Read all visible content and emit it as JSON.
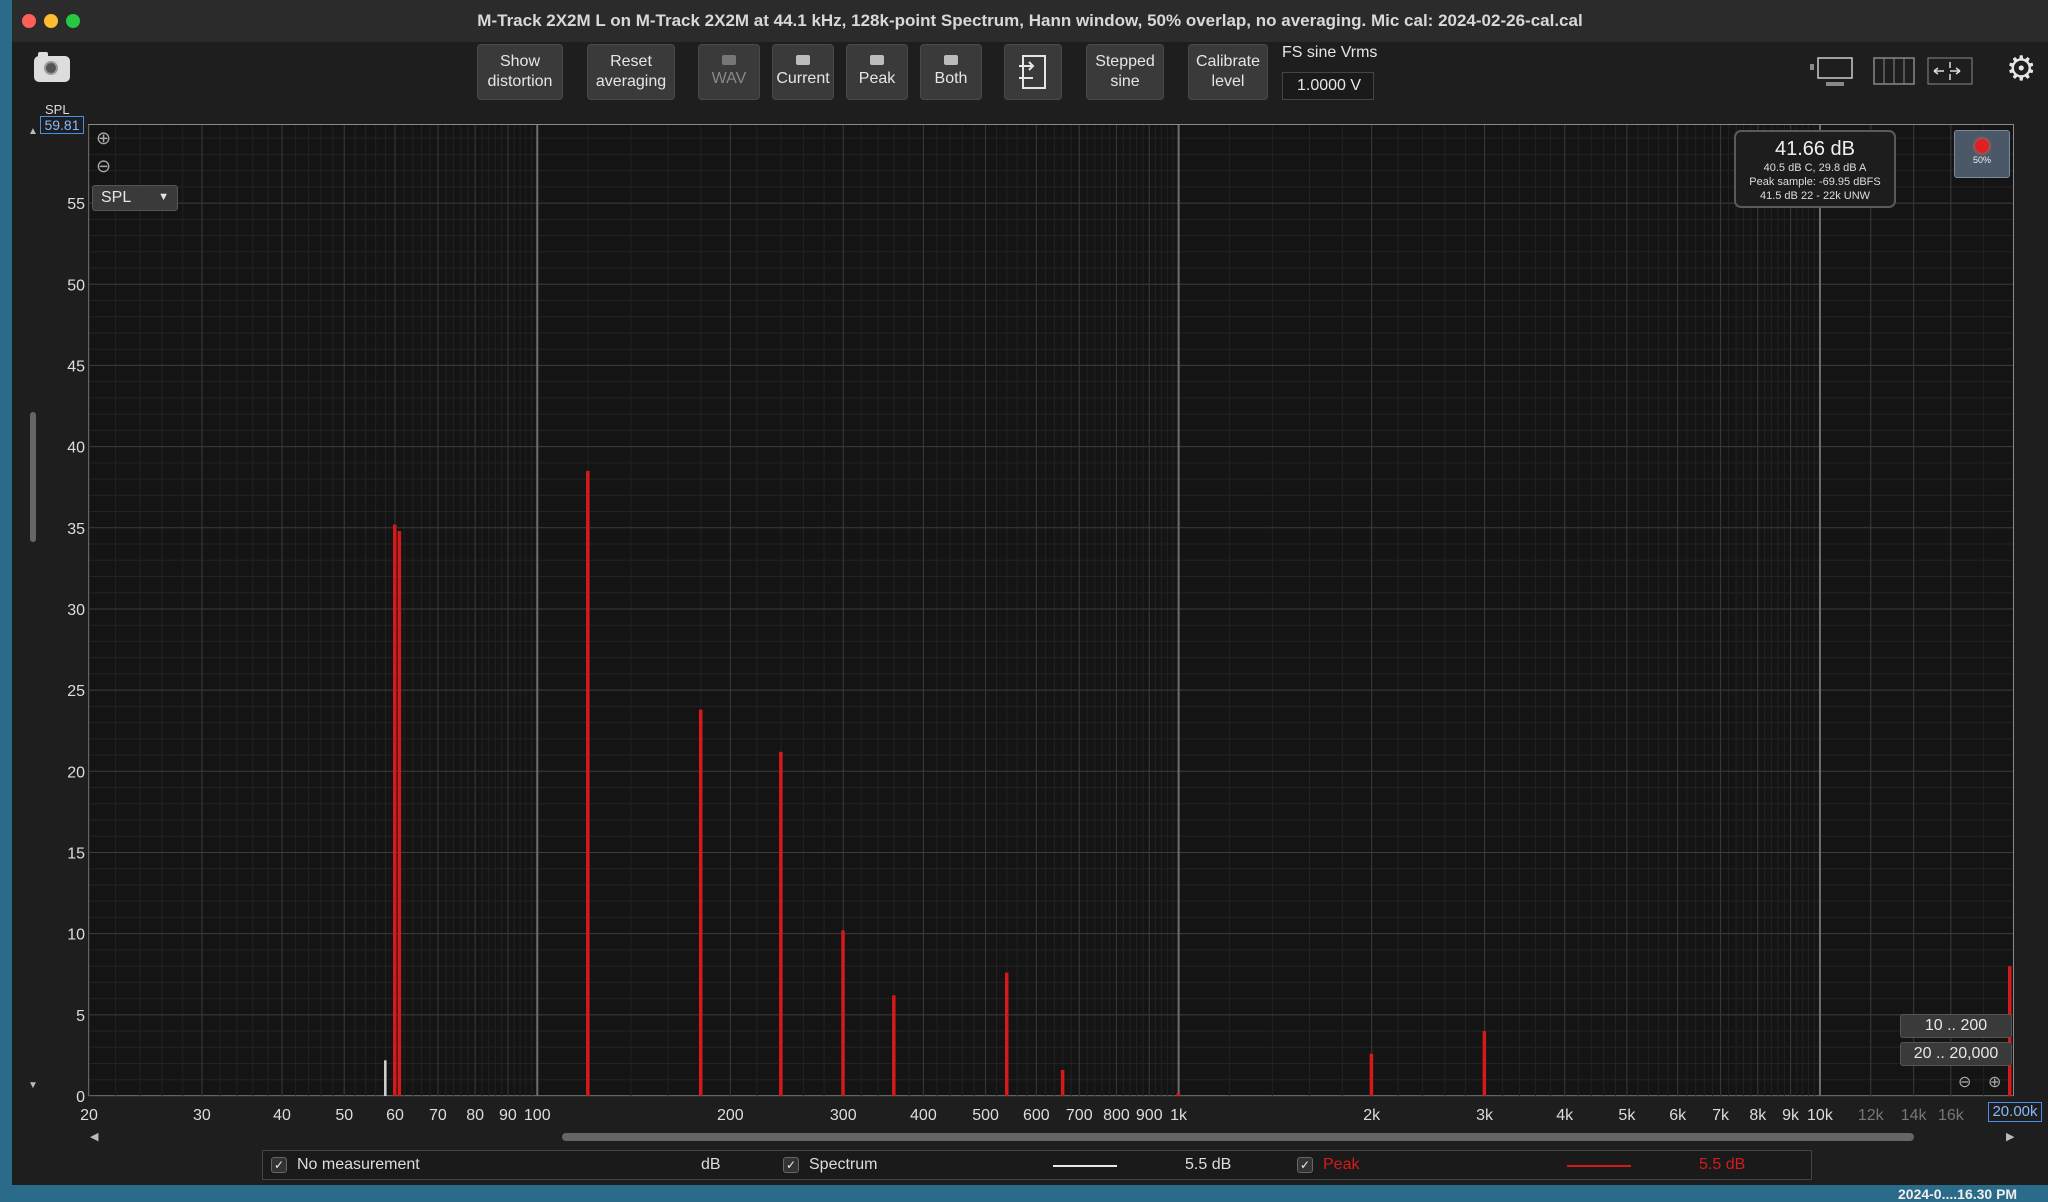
{
  "window": {
    "title": "M-Track 2X2M  L on M-Track 2X2M at 44.1 kHz, 128k-point Spectrum, Hann window, 50% overlap, no averaging. Mic cal: 2024-02-26-cal.cal"
  },
  "toolbar": {
    "show_distortion": [
      "Show",
      "distortion"
    ],
    "reset_averaging": [
      "Reset",
      "averaging"
    ],
    "wav": "WAV",
    "current": "Current",
    "peak": "Peak",
    "both": "Both",
    "stepped_sine": [
      "Stepped",
      "sine"
    ],
    "calibrate_level": [
      "Calibrate",
      "level"
    ],
    "fs_sine_label": "FS sine Vrms",
    "fs_sine_value": "1.0000 V"
  },
  "axis": {
    "y_title": "SPL",
    "y_max_value": "59.81",
    "x_max_value": "20.00k",
    "y_selector": "SPL"
  },
  "readout": {
    "main": "41.66 dB",
    "line1": "40.5 dB C, 29.8 dB A",
    "line2": "Peak sample: -69.95 dBFS",
    "line3": "41.5 dB 22 - 22k UNW",
    "record_pct": "50%"
  },
  "ranges": {
    "r1": "10 .. 200",
    "r2": "20 .. 20,000"
  },
  "legend": {
    "no_measurement": "No measurement",
    "unit": "dB",
    "spectrum": "Spectrum",
    "spectrum_value": "5.5 dB",
    "peak": "Peak",
    "peak_value": "5.5 dB",
    "spectrum_color": "#e8e8e8",
    "peak_color": "#d41a1a"
  },
  "desktop": {
    "clock": "2024-0....16.30 PM"
  },
  "chart_data": {
    "type": "bar",
    "x_scale": "log",
    "xlim": [
      20,
      20000
    ],
    "ylim": [
      0,
      59.81
    ],
    "ylabel": "SPL",
    "grid": true,
    "y_ticks": [
      0,
      5,
      10,
      15,
      20,
      25,
      30,
      35,
      40,
      45,
      50,
      55
    ],
    "x_ticks": [
      {
        "v": 20,
        "l": "20"
      },
      {
        "v": 30,
        "l": "30"
      },
      {
        "v": 40,
        "l": "40"
      },
      {
        "v": 50,
        "l": "50"
      },
      {
        "v": 60,
        "l": "60"
      },
      {
        "v": 70,
        "l": "70"
      },
      {
        "v": 80,
        "l": "80"
      },
      {
        "v": 90,
        "l": "90"
      },
      {
        "v": 100,
        "l": "100"
      },
      {
        "v": 200,
        "l": "200"
      },
      {
        "v": 300,
        "l": "300"
      },
      {
        "v": 400,
        "l": "400"
      },
      {
        "v": 500,
        "l": "500"
      },
      {
        "v": 600,
        "l": "600"
      },
      {
        "v": 700,
        "l": "700"
      },
      {
        "v": 800,
        "l": "800"
      },
      {
        "v": 900,
        "l": "900"
      },
      {
        "v": 1000,
        "l": "1k"
      },
      {
        "v": 2000,
        "l": "2k"
      },
      {
        "v": 3000,
        "l": "3k"
      },
      {
        "v": 4000,
        "l": "4k"
      },
      {
        "v": 5000,
        "l": "5k"
      },
      {
        "v": 6000,
        "l": "6k"
      },
      {
        "v": 7000,
        "l": "7k"
      },
      {
        "v": 8000,
        "l": "8k"
      },
      {
        "v": 9000,
        "l": "9k"
      },
      {
        "v": 10000,
        "l": "10k"
      },
      {
        "v": 12000,
        "l": "12k"
      },
      {
        "v": 14000,
        "l": "14k"
      },
      {
        "v": 16000,
        "l": "16k"
      }
    ],
    "series": [
      {
        "name": "Spectrum",
        "points": [
          {
            "x": 58,
            "y": 2.2
          },
          {
            "x": 60,
            "y": 34.5
          },
          {
            "x": 61,
            "y": 33.0
          },
          {
            "x": 120,
            "y": 38.5
          },
          {
            "x": 180,
            "y": 23.6
          },
          {
            "x": 240,
            "y": 20.8
          },
          {
            "x": 300,
            "y": 9.6
          },
          {
            "x": 360,
            "y": 5.8
          },
          {
            "x": 540,
            "y": 6.8
          },
          {
            "x": 3000,
            "y": 1.2
          },
          {
            "x": 20000,
            "y": 5.8
          }
        ]
      },
      {
        "name": "Peak",
        "points": [
          {
            "x": 60,
            "y": 35.2
          },
          {
            "x": 61,
            "y": 34.8
          },
          {
            "x": 120,
            "y": 38.5
          },
          {
            "x": 180,
            "y": 23.8
          },
          {
            "x": 240,
            "y": 21.2
          },
          {
            "x": 300,
            "y": 10.2
          },
          {
            "x": 360,
            "y": 6.2
          },
          {
            "x": 540,
            "y": 7.6
          },
          {
            "x": 660,
            "y": 1.6
          },
          {
            "x": 1000,
            "y": 0.2
          },
          {
            "x": 2000,
            "y": 2.6
          },
          {
            "x": 3000,
            "y": 4.0
          },
          {
            "x": 20000,
            "y": 8.0
          }
        ]
      }
    ]
  }
}
